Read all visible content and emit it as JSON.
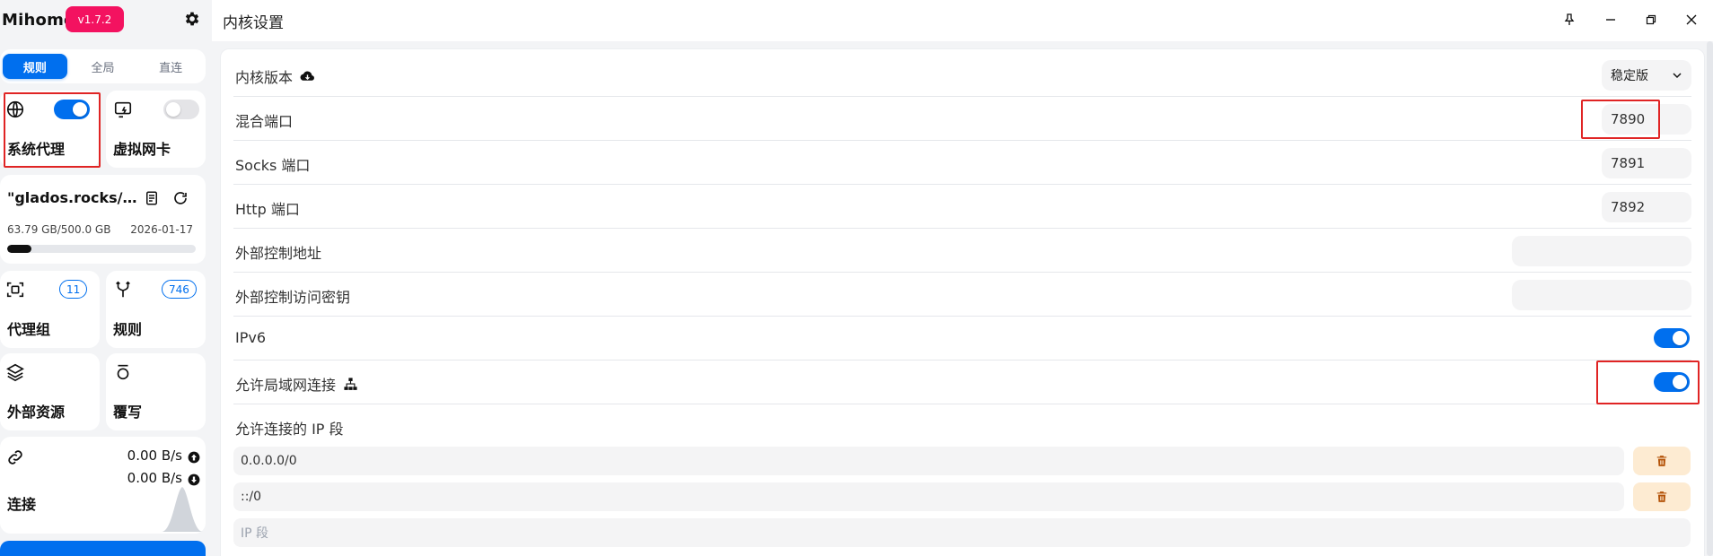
{
  "app": {
    "brand": "Mihomo",
    "version": "v1.7.2"
  },
  "sidebar": {
    "modes": [
      "规则",
      "全局",
      "直连"
    ],
    "active_mode": "规则",
    "system_proxy": {
      "label": "系统代理",
      "enabled": true
    },
    "virtual_nic": {
      "label": "虚拟网卡",
      "enabled": false
    },
    "profile": {
      "name": "\"glados.rocks/1...",
      "usage": "63.79 GB/500.0 GB",
      "date": "2026-01-17",
      "used_fraction": 0.128
    },
    "proxy_group": {
      "label": "代理组",
      "count": "11"
    },
    "rules": {
      "label": "规则",
      "count": "746"
    },
    "resources": {
      "label": "外部资源"
    },
    "override": {
      "label": "覆写"
    },
    "connections": {
      "label": "连接",
      "upload": "0.00 B/s",
      "download": "0.00 B/s"
    }
  },
  "titlebar": {
    "title": "内核设置"
  },
  "settings": {
    "core_version": {
      "label": "内核版本",
      "value": "稳定版"
    },
    "mixed_port": {
      "label": "混合端口",
      "value": "7890"
    },
    "socks_port": {
      "label": "Socks 端口",
      "value": "7891"
    },
    "http_port": {
      "label": "Http 端口",
      "value": "7892"
    },
    "ext_controller": {
      "label": "外部控制地址",
      "value": ""
    },
    "ext_secret": {
      "label": "外部控制访问密钥",
      "value": ""
    },
    "ipv6": {
      "label": "IPv6",
      "enabled": true
    },
    "allow_lan": {
      "label": "允许局域网连接",
      "enabled": true
    },
    "lan_ip_section": {
      "label": "允许连接的 IP 段",
      "entries": [
        "0.0.0.0/0",
        "::/0"
      ],
      "placeholder": "IP 段"
    }
  },
  "colors": {
    "accent": "#006fee",
    "badge": "#f31260",
    "highlight": "#e02424",
    "delete_bg": "#fdebd2",
    "delete_icon": "#b45309"
  }
}
